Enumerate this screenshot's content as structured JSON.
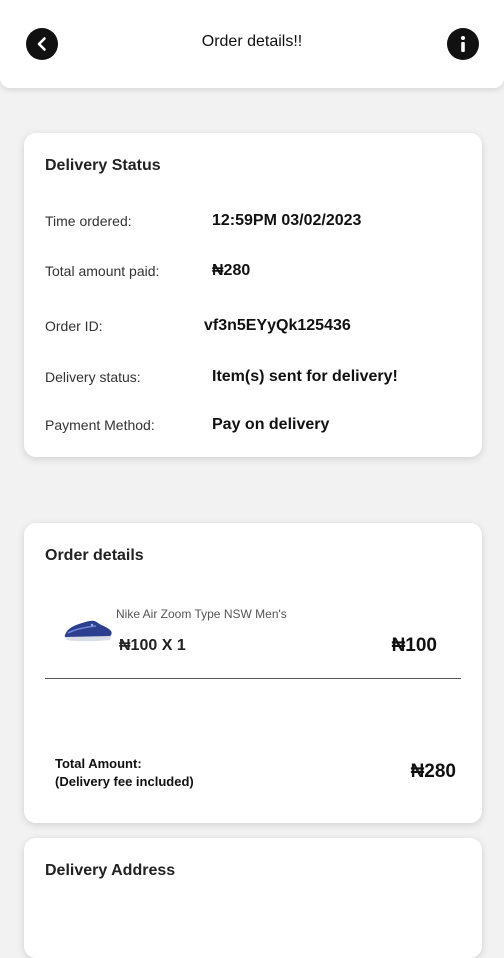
{
  "appbar": {
    "title": "Order details!!",
    "back_icon": "chevron-left-icon",
    "info_icon": "info-icon"
  },
  "delivery_status": {
    "title": "Delivery Status",
    "rows": [
      {
        "label": "Time ordered:",
        "value": "12:59PM 03/02/2023"
      },
      {
        "label": "Total amount paid:",
        "value": "₦280"
      },
      {
        "label": "Order ID:",
        "value": "vf3n5EYyQk125436"
      },
      {
        "label": "Delivery status:",
        "value": "Item(s) sent for delivery!"
      },
      {
        "label": "Payment Method:",
        "value": "Pay on delivery"
      }
    ]
  },
  "order_details": {
    "title": "Order details",
    "items": [
      {
        "name": "Nike Air Zoom Type NSW Men's",
        "qty_line": "₦100 X 1",
        "price": "₦100"
      }
    ],
    "total_label_line1": "Total Amount:",
    "total_label_line2": "(Delivery fee included)",
    "total_value": "₦280"
  },
  "delivery_address": {
    "title": "Delivery Address"
  },
  "colors": {
    "background": "#f2f2f2",
    "card": "#ffffff",
    "text": "#111111",
    "icon_bg": "#111111"
  }
}
